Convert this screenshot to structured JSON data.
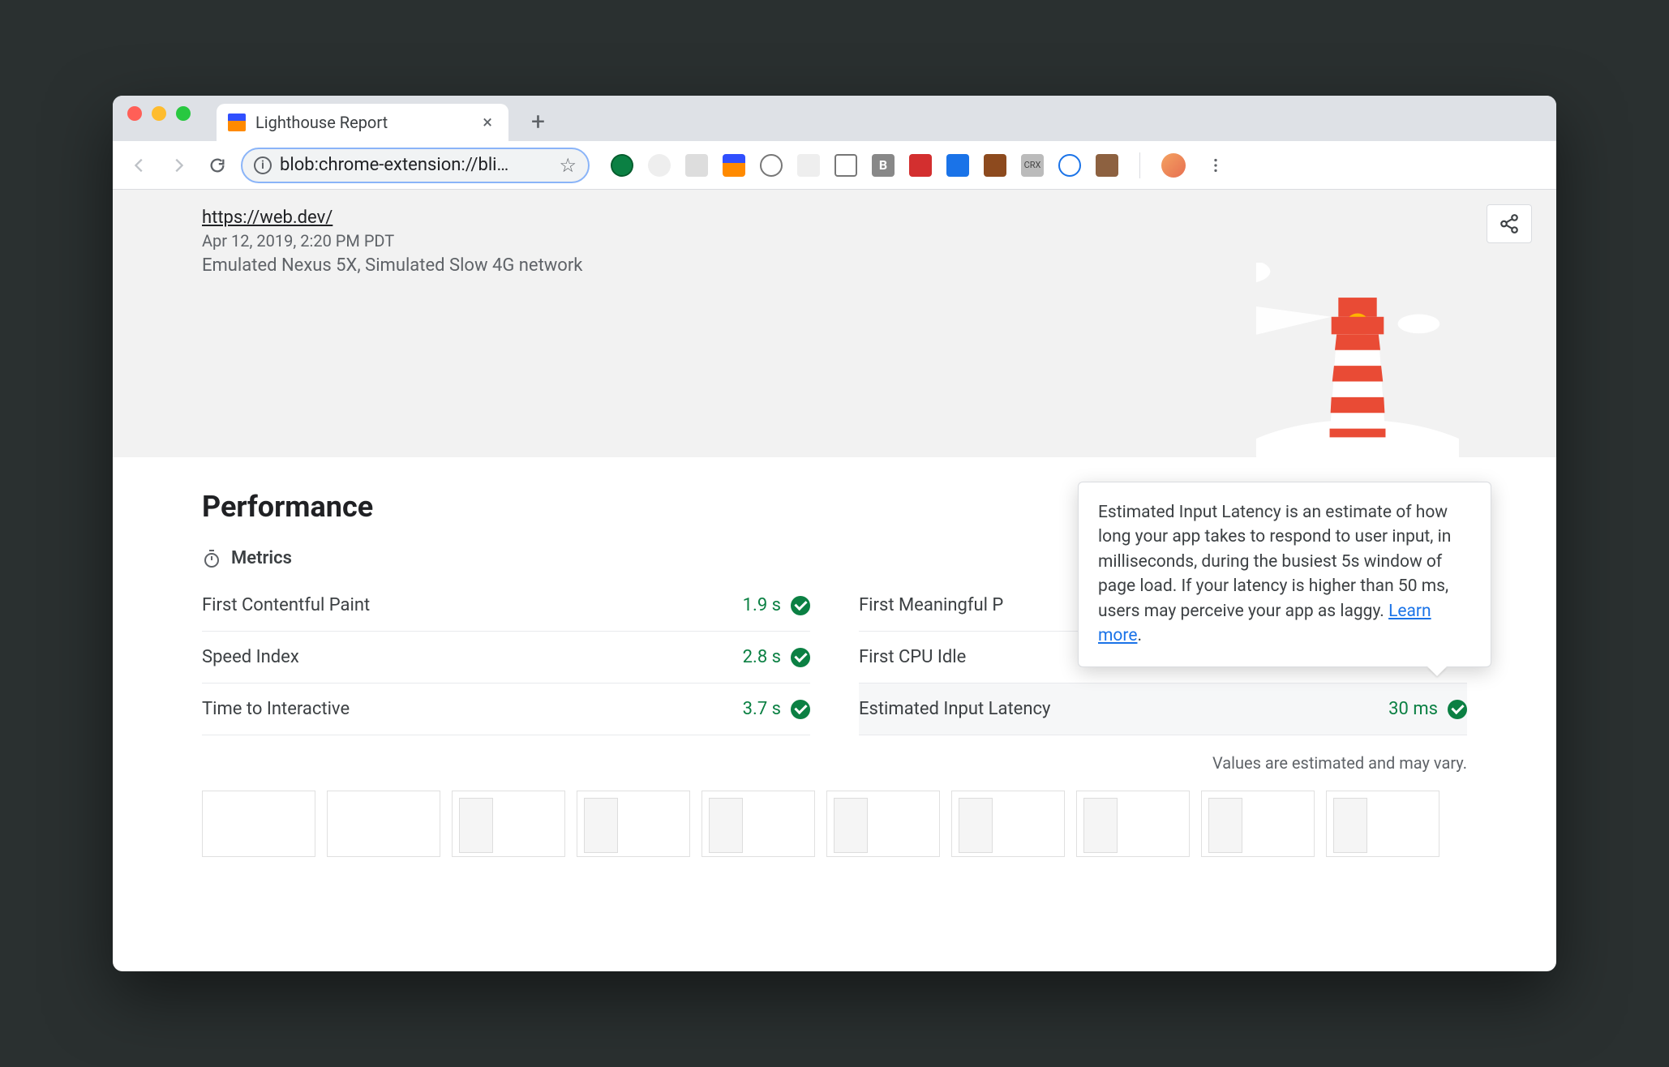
{
  "tab": {
    "title": "Lighthouse Report"
  },
  "toolbar": {
    "url": "blob:chrome-extension://bli…"
  },
  "report": {
    "url": "https://web.dev/",
    "timestamp": "Apr 12, 2019, 2:20 PM PDT",
    "env": "Emulated Nexus 5X, Simulated Slow 4G network"
  },
  "section": {
    "title": "Performance",
    "metrics_heading": "Metrics",
    "footnote": "Values are estimated and may vary."
  },
  "metrics": {
    "left": [
      {
        "label": "First Contentful Paint",
        "value": "1.9 s"
      },
      {
        "label": "Speed Index",
        "value": "2.8 s"
      },
      {
        "label": "Time to Interactive",
        "value": "3.7 s"
      }
    ],
    "right": [
      {
        "label": "First Meaningful P",
        "value": ""
      },
      {
        "label": "First CPU Idle",
        "value": ""
      },
      {
        "label": "Estimated Input Latency",
        "value": "30 ms"
      }
    ]
  },
  "tooltip": {
    "text": "Estimated Input Latency is an estimate of how long your app takes to respond to user input, in milliseconds, during the busiest 5s window of page load. If your latency is higher than 50 ms, users may perceive your app as laggy. ",
    "link": "Learn more"
  }
}
